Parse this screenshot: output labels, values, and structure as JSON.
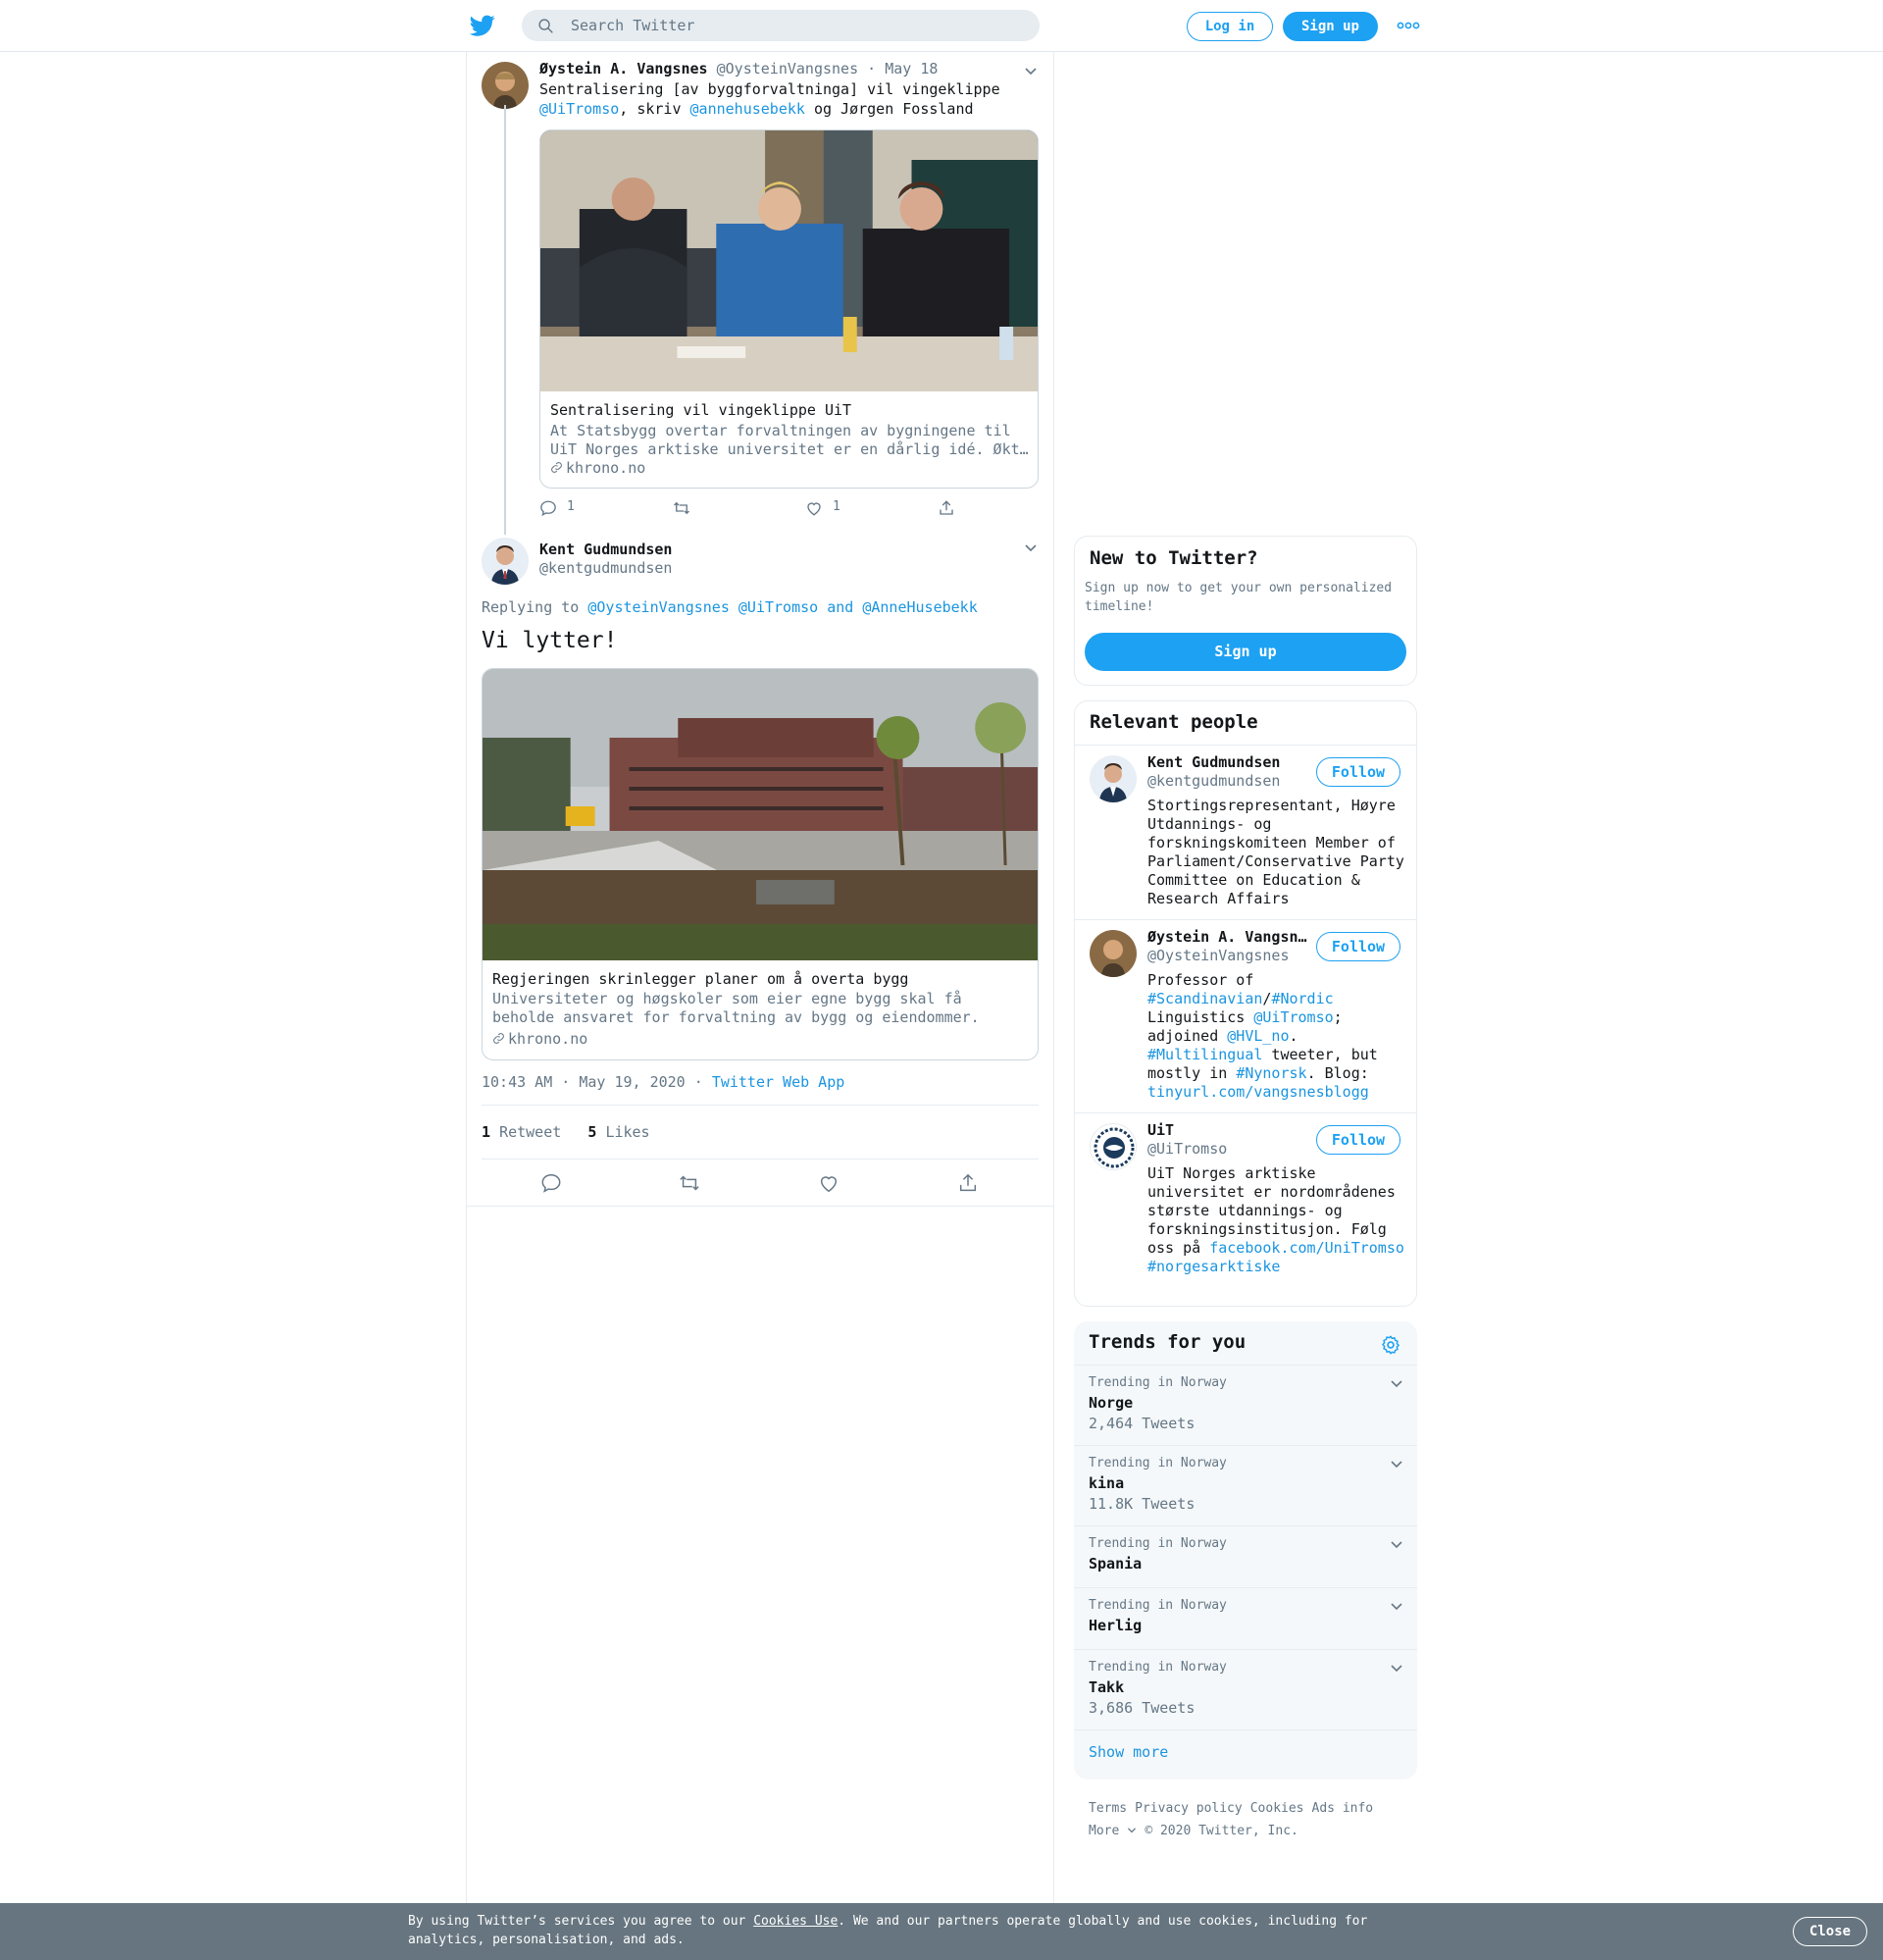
{
  "header": {
    "search_placeholder": "Search Twitter",
    "login_label": "Log in",
    "signup_label": "Sign up",
    "brand_color": "#1da1f2"
  },
  "tweet1": {
    "author_name": "Øystein A. Vangsnes",
    "author_handle": "@OysteinVangsnes",
    "date": "May 18",
    "text_before": "Sentralisering [av byggforvaltninga] vil vingeklippe ",
    "mention1": "@UiTromso",
    "text_mid": ", skriv ",
    "mention2": "@annehusebekk",
    "text_after": " og Jørgen Fossland",
    "card": {
      "title": "Sentralisering vil vingeklippe UiT",
      "description": "At Statsbygg overtar forvaltningen av bygningene til UiT Norges arktiske universitet er en dårlig idé. Økt…",
      "domain": "khrono.no"
    },
    "reply_count": "1",
    "like_count": "1"
  },
  "tweet2": {
    "author_name": "Kent Gudmundsen",
    "author_handle": "@kentgudmundsen",
    "replying_label": "Replying to",
    "reply_mention1": "@OysteinVangsnes",
    "reply_mention2": "@UiTromso",
    "reply_and": "and",
    "reply_mention3": "@AnneHusebekk",
    "text": "Vi lytter!",
    "card": {
      "title": "Regjeringen skrinlegger planer om å overta bygg",
      "description": "Universiteter og høgskoler som eier egne bygg skal få beholde ansvaret for forvaltning av bygg og eiendommer.",
      "domain": "khrono.no"
    },
    "time": "10:43 AM · May 19, 2020 ·",
    "source": "Twitter Web App",
    "retweet_count": "1",
    "retweet_label": "Retweet",
    "like_count": "5",
    "like_label": "Likes"
  },
  "new_to_twitter": {
    "title": "New to Twitter?",
    "subtitle": "Sign up now to get your own personalized timeline!",
    "signup_label": "Sign up"
  },
  "relevant_people": {
    "title": "Relevant people",
    "follow_label": "Follow",
    "people": [
      {
        "name": "Kent Gudmundsen",
        "handle": "@kentgudmundsen",
        "bio": "Stortingsrepresentant, Høyre Utdannings- og forskningskomiteen Member of Parliament/Conservative Party Committee on Education & Research Affairs"
      },
      {
        "name": "Øystein A. Vangsnes",
        "handle": "@OysteinVangsnes",
        "bio_parts": [
          "Professor of ",
          "#Scandinavian",
          "/",
          "#Nordic",
          " Linguistics ",
          "@UiTromso",
          "; adjoined ",
          "@HVL_no",
          ". ",
          "#Multilingual",
          " tweeter, but mostly in ",
          "#Nynorsk",
          ". Blog: ",
          "tinyurl.com/vangsnesblogg"
        ]
      },
      {
        "name": "UiT",
        "handle": "@UiTromso",
        "bio_text": "UiT Norges arktiske universitet er nordområdenes største utdannings- og forskningsinstitusjon. Følg oss på ",
        "bio_link1": "facebook.com/UniTromso",
        "bio_link2": "#norgesarktiske"
      }
    ]
  },
  "trends": {
    "title": "Trends for you",
    "items": [
      {
        "context": "Trending in Norway",
        "name": "Norge",
        "count": "2,464 Tweets"
      },
      {
        "context": "Trending in Norway",
        "name": "kina",
        "count": "11.8K Tweets"
      },
      {
        "context": "Trending in Norway",
        "name": "Spania",
        "count": ""
      },
      {
        "context": "Trending in Norway",
        "name": "Herlig",
        "count": ""
      },
      {
        "context": "Trending in Norway",
        "name": "Takk",
        "count": "3,686 Tweets"
      }
    ],
    "show_more": "Show more"
  },
  "footer": {
    "terms": "Terms",
    "privacy": "Privacy policy",
    "cookies": "Cookies",
    "ads": "Ads info",
    "more": "More",
    "copyright": "© 2020 Twitter, Inc."
  },
  "cookie_bar": {
    "text_before": "By using Twitter’s services you agree to our ",
    "link": "Cookies Use",
    "text_after": ". We and our partners operate globally and use cookies, including for analytics, personalisation, and ads.",
    "close_label": "Close"
  }
}
